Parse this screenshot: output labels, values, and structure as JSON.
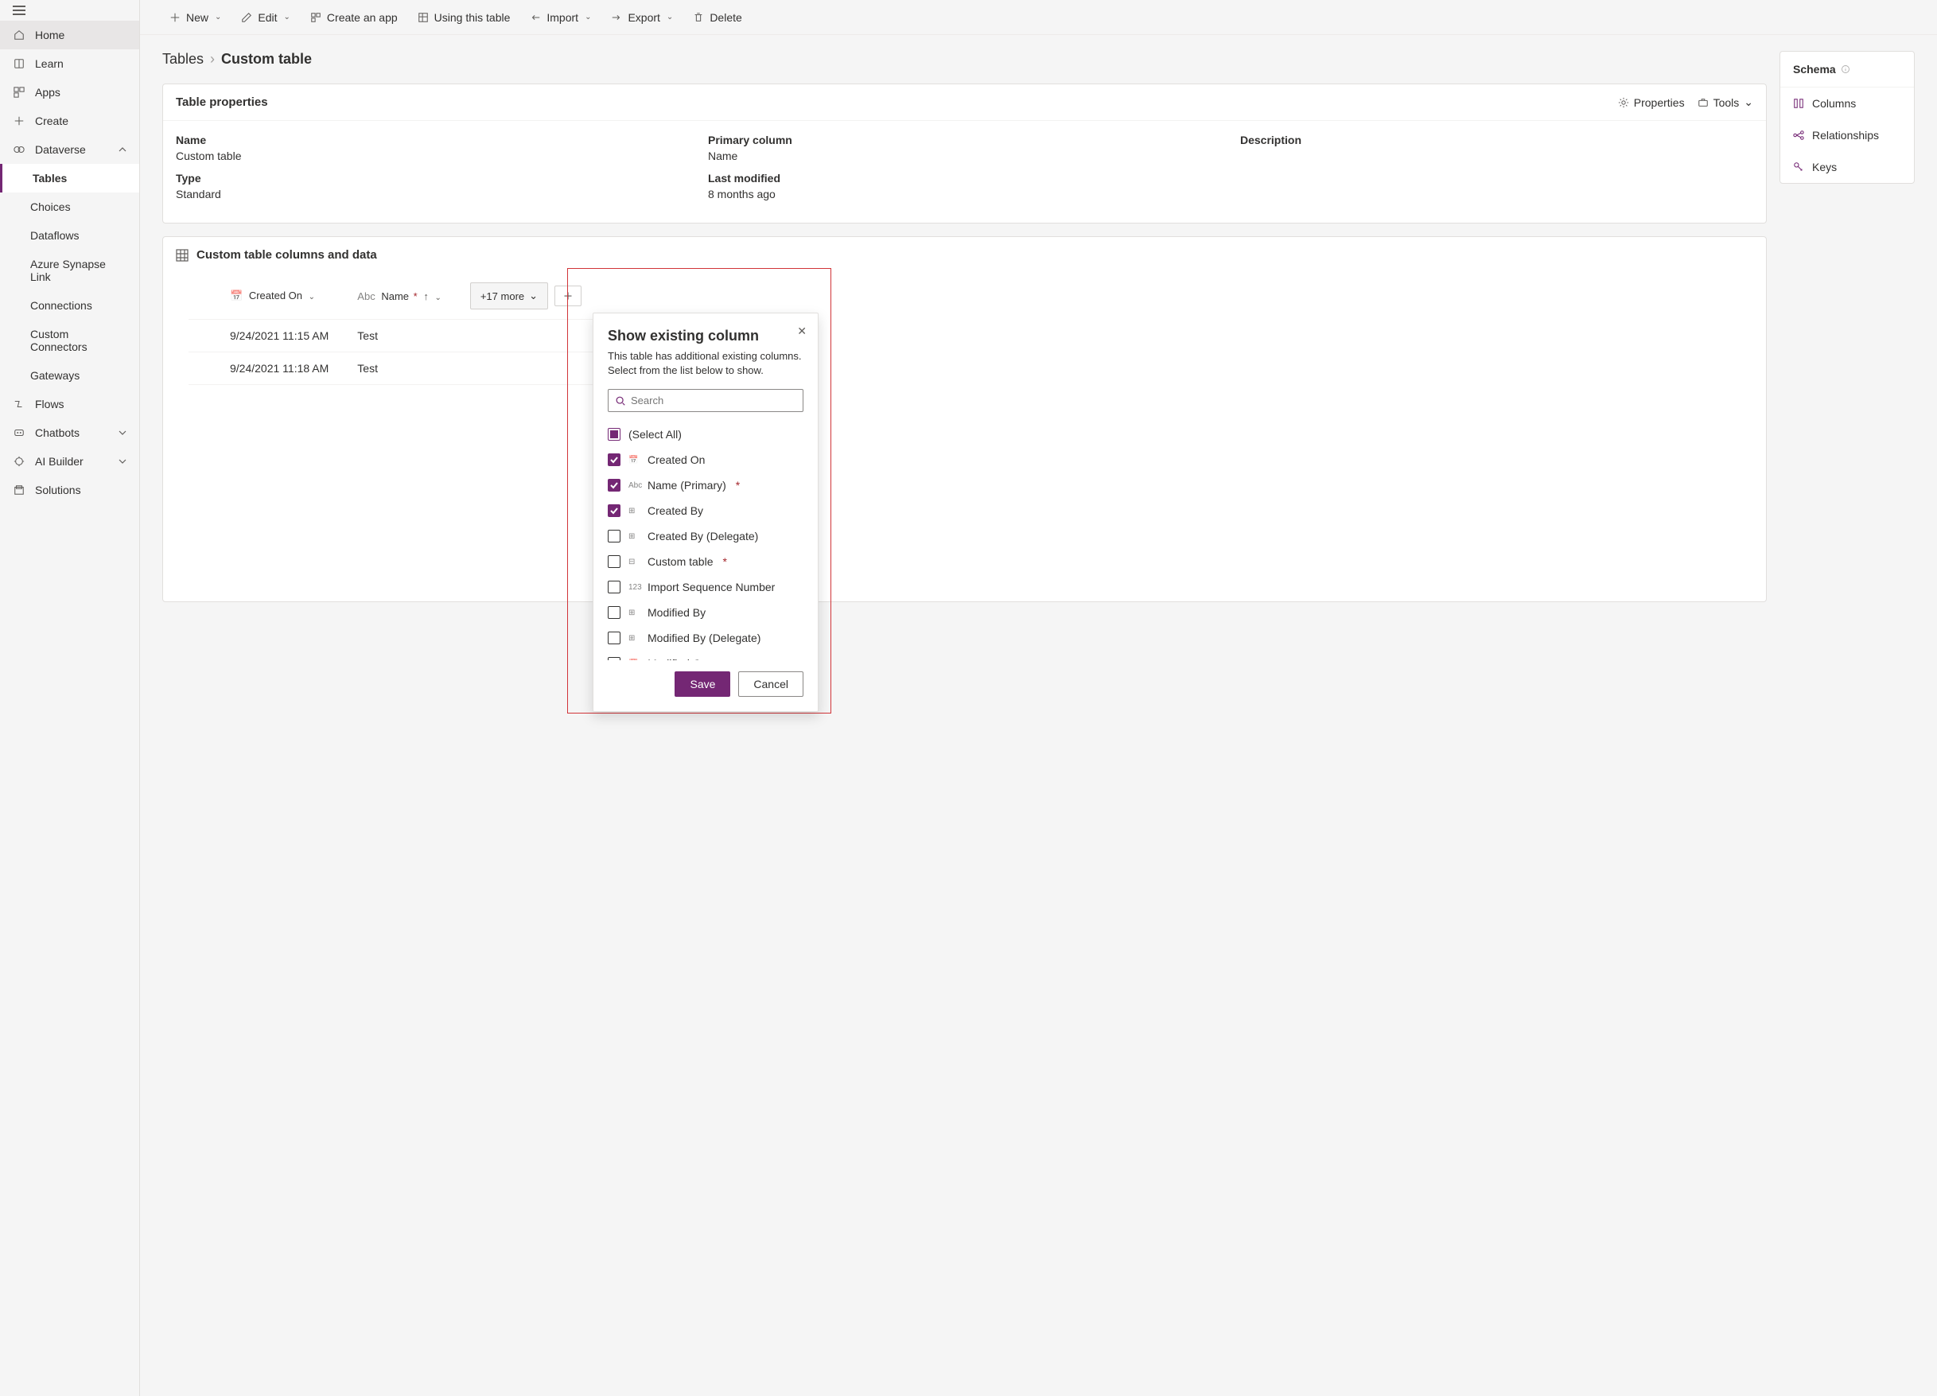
{
  "sidebar": {
    "items": [
      {
        "label": "Home"
      },
      {
        "label": "Learn"
      },
      {
        "label": "Apps"
      },
      {
        "label": "Create"
      },
      {
        "label": "Dataverse"
      },
      {
        "label": "Tables"
      },
      {
        "label": "Choices"
      },
      {
        "label": "Dataflows"
      },
      {
        "label": "Azure Synapse Link"
      },
      {
        "label": "Connections"
      },
      {
        "label": "Custom Connectors"
      },
      {
        "label": "Gateways"
      },
      {
        "label": "Flows"
      },
      {
        "label": "Chatbots"
      },
      {
        "label": "AI Builder"
      },
      {
        "label": "Solutions"
      }
    ]
  },
  "toolbar": {
    "new": "New",
    "edit": "Edit",
    "create_app": "Create an app",
    "using_table": "Using this table",
    "import": "Import",
    "export": "Export",
    "delete": "Delete"
  },
  "breadcrumb": {
    "root": "Tables",
    "current": "Custom table"
  },
  "props_card": {
    "title": "Table properties",
    "properties_btn": "Properties",
    "tools_btn": "Tools",
    "name_label": "Name",
    "name_value": "Custom table",
    "primary_label": "Primary column",
    "primary_value": "Name",
    "desc_label": "Description",
    "desc_value": "",
    "type_label": "Type",
    "type_value": "Standard",
    "modified_label": "Last modified",
    "modified_value": "8 months ago"
  },
  "schema_card": {
    "title": "Schema",
    "columns": "Columns",
    "relationships": "Relationships",
    "keys": "Keys"
  },
  "data_card": {
    "title": "Custom table columns and data",
    "col_created": "Created On",
    "col_name": "Name",
    "more_label": "+17 more",
    "rows": [
      {
        "created": "9/24/2021 11:15 AM",
        "name": "Test"
      },
      {
        "created": "9/24/2021 11:18 AM",
        "name": "Test"
      }
    ]
  },
  "popup": {
    "title": "Show existing column",
    "desc": "This table has additional existing columns. Select from the list below to show.",
    "search_placeholder": "Search",
    "select_all": "(Select All)",
    "cols": [
      {
        "label": "Created On",
        "checked": true,
        "icon": "date"
      },
      {
        "label": "Name (Primary)",
        "checked": true,
        "icon": "text",
        "required": true
      },
      {
        "label": "Created By",
        "checked": true,
        "icon": "lookup"
      },
      {
        "label": "Created By (Delegate)",
        "checked": false,
        "icon": "lookup"
      },
      {
        "label": "Custom table",
        "checked": false,
        "icon": "key",
        "required": true
      },
      {
        "label": "Import Sequence Number",
        "checked": false,
        "icon": "number"
      },
      {
        "label": "Modified By",
        "checked": false,
        "icon": "lookup"
      },
      {
        "label": "Modified By (Delegate)",
        "checked": false,
        "icon": "lookup"
      },
      {
        "label": "Modified On",
        "checked": false,
        "icon": "date"
      }
    ],
    "save": "Save",
    "cancel": "Cancel"
  }
}
